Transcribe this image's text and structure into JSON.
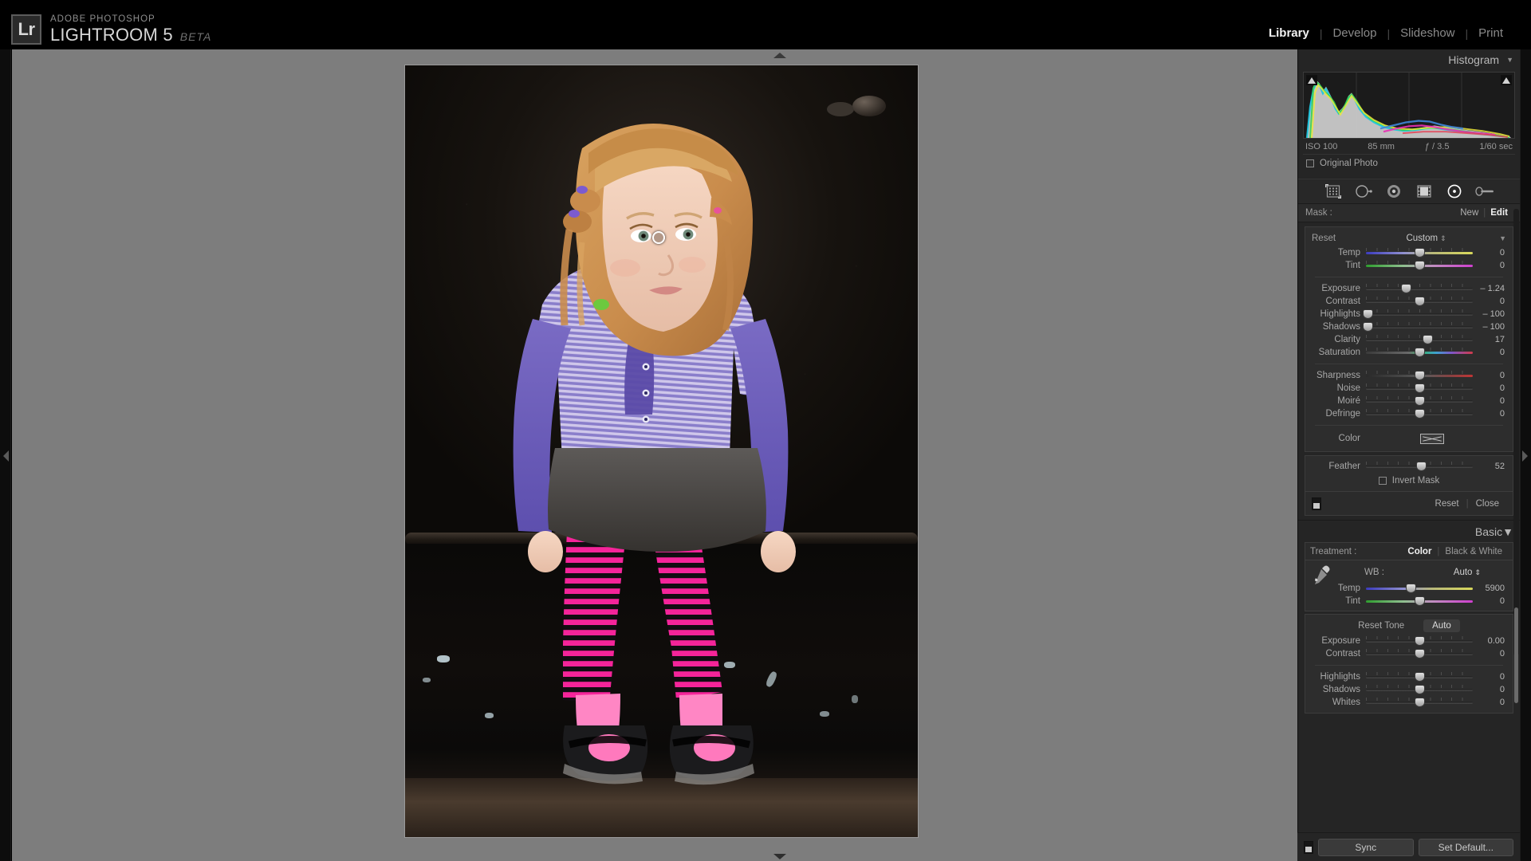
{
  "app": {
    "brand_sup": "ADOBE PHOTOSHOP",
    "brand_main": "LIGHTROOM 5",
    "brand_beta": "BETA",
    "badge": "Lr"
  },
  "modules": [
    {
      "label": "Library",
      "active": false
    },
    {
      "label": "Develop",
      "active": true
    },
    {
      "label": "Slideshow",
      "active": false
    },
    {
      "label": "Print",
      "active": false
    }
  ],
  "module_separator": "|",
  "histogram": {
    "title": "Histogram",
    "collapse_glyph": "▼",
    "exif": {
      "iso": "ISO 100",
      "focal": "85 mm",
      "aperture": "ƒ / 3.5",
      "shutter": "1/60 sec"
    },
    "original_photo_label": "Original Photo",
    "original_photo_checked": false
  },
  "tools": [
    {
      "name": "crop-overlay",
      "active": false
    },
    {
      "name": "spot-removal",
      "active": false
    },
    {
      "name": "red-eye-correction",
      "active": false
    },
    {
      "name": "graduated-filter",
      "active": false
    },
    {
      "name": "radial-filter",
      "active": true
    },
    {
      "name": "adjustment-brush",
      "active": false
    }
  ],
  "mask": {
    "label": "Mask :",
    "new_label": "New",
    "edit_label": "Edit",
    "separator": "|",
    "active": "Edit"
  },
  "local_panel": {
    "reset_label": "Reset",
    "effect_label": "Custom",
    "effect_glyph": "⇕",
    "collapse_glyph": "▼",
    "sliders": [
      {
        "name": "Temp",
        "value": "0",
        "pos": 50,
        "track": "temp"
      },
      {
        "name": "Tint",
        "value": "0",
        "pos": 50,
        "track": "tint"
      },
      {
        "name": "Exposure",
        "value": "– 1.24",
        "pos": 38,
        "track": ""
      },
      {
        "name": "Contrast",
        "value": "0",
        "pos": 50,
        "track": ""
      },
      {
        "name": "Highlights",
        "value": "– 100",
        "pos": 2,
        "track": ""
      },
      {
        "name": "Shadows",
        "value": "– 100",
        "pos": 2,
        "track": ""
      },
      {
        "name": "Clarity",
        "value": "17",
        "pos": 58,
        "track": ""
      },
      {
        "name": "Saturation",
        "value": "0",
        "pos": 50,
        "track": "sat"
      },
      {
        "name": "Sharpness",
        "value": "0",
        "pos": 50,
        "track": "sharp"
      },
      {
        "name": "Noise",
        "value": "0",
        "pos": 50,
        "track": ""
      },
      {
        "name": "Moiré",
        "value": "0",
        "pos": 50,
        "track": ""
      },
      {
        "name": "Defringe",
        "value": "0",
        "pos": 50,
        "track": ""
      }
    ],
    "color_label": "Color",
    "feather": {
      "name": "Feather",
      "value": "52",
      "pos": 52
    },
    "invert_mask_label": "Invert Mask",
    "invert_mask_checked": false,
    "footer_reset": "Reset",
    "footer_close": "Close",
    "footer_separator": "|"
  },
  "basic": {
    "title": "Basic",
    "collapse_glyph": "▼",
    "treatment_label": "Treatment :",
    "treatment_color": "Color",
    "treatment_bw": "Black & White",
    "treatment_separator": "|",
    "treatment_active": "Color",
    "wb_label": "WB :",
    "wb_value": "Auto",
    "wb_glyph": "⇕",
    "wb_sliders": [
      {
        "name": "Temp",
        "value": "5900",
        "pos": 42,
        "track": "temp"
      },
      {
        "name": "Tint",
        "value": "0",
        "pos": 50,
        "track": "tint"
      }
    ],
    "reset_tone_label": "Reset Tone",
    "auto_label": "Auto",
    "tone_sliders": [
      {
        "name": "Exposure",
        "value": "0.00",
        "pos": 50,
        "track": ""
      },
      {
        "name": "Contrast",
        "value": "0",
        "pos": 50,
        "track": ""
      }
    ],
    "tone_sliders2": [
      {
        "name": "Highlights",
        "value": "0",
        "pos": 50,
        "track": ""
      },
      {
        "name": "Shadows",
        "value": "0",
        "pos": 50,
        "track": ""
      },
      {
        "name": "Whites",
        "value": "0",
        "pos": 50,
        "track": ""
      }
    ]
  },
  "bottom_bar": {
    "sync_label": "Sync",
    "set_default_label": "Set Default..."
  },
  "photo": {
    "alt": "young girl sitting on dark weathered metal ledge"
  },
  "colors": {
    "panel_bg": "#252525",
    "canvas_bg": "#7d7d7d",
    "accent_text": "#f0f0f0",
    "label_text": "#a8a8a8"
  }
}
